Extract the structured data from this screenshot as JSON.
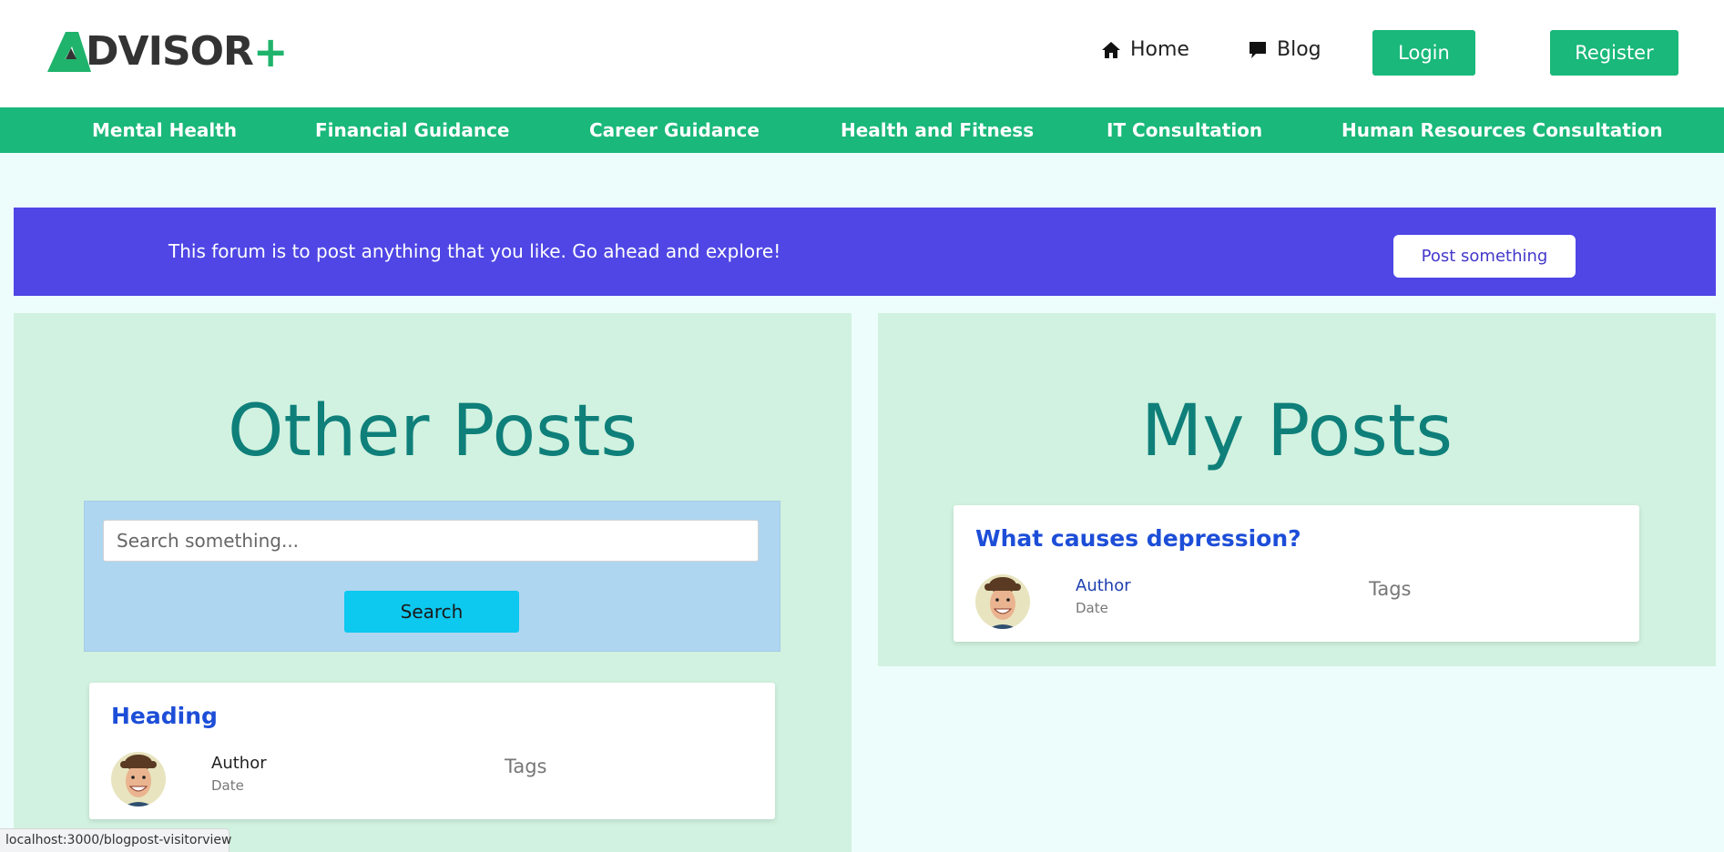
{
  "header": {
    "logo_text": "DVISOR",
    "logo_plus": "+",
    "nav": {
      "home_label": "Home",
      "blog_label": "Blog"
    },
    "login_label": "Login",
    "register_label": "Register"
  },
  "categories": [
    "Mental Health",
    "Financial Guidance",
    "Career Guidance",
    "Health and Fitness",
    "IT Consultation",
    "Human Resources Consultation"
  ],
  "banner": {
    "text": "This forum is to post anything that you like. Go ahead and explore!",
    "button_label": "Post something"
  },
  "other_posts": {
    "title": "Other Posts",
    "search_placeholder": "Search something...",
    "search_button": "Search",
    "post": {
      "heading": "Heading",
      "author": "Author",
      "date": "Date",
      "tags": "Tags"
    }
  },
  "my_posts": {
    "title": "My Posts",
    "post": {
      "heading": "What causes depression?",
      "author": "Author",
      "date": "Date",
      "tags": "Tags"
    }
  },
  "status_bar": {
    "url": "localhost:3000/blogpost-visitorview"
  },
  "colors": {
    "brand_green": "#1ab87a",
    "banner_purple": "#4f46e5",
    "title_teal": "#0f7f7a",
    "link_blue": "#1d4ed8",
    "search_cyan": "#0dc8ef"
  }
}
